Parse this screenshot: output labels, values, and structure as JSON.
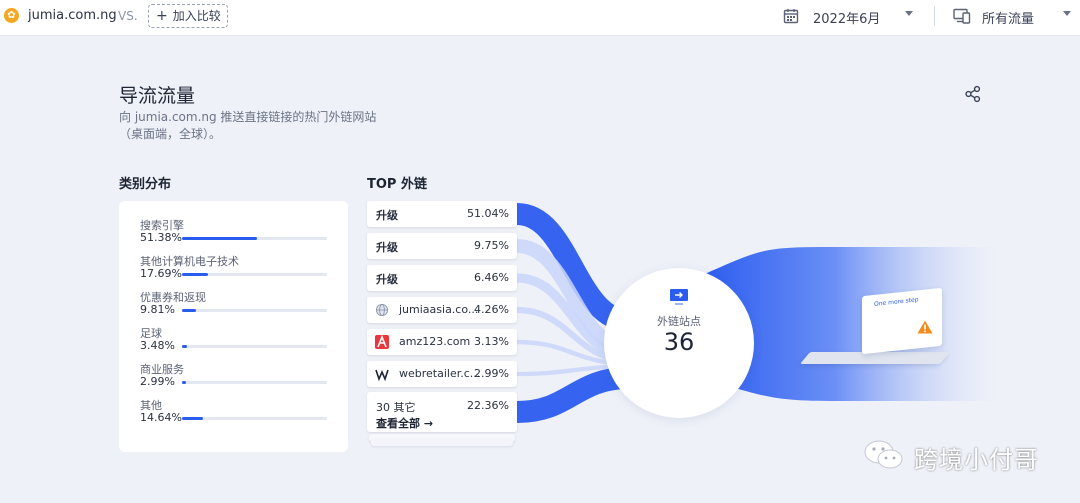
{
  "topbar": {
    "site": "jumia.com.ng",
    "vs": "VS.",
    "compare_label": "加入比较",
    "date": "2022年6月",
    "traffic_type": "所有流量"
  },
  "section": {
    "title": "导流流量",
    "description": "向 jumia.com.ng 推送直接链接的热门外链网站（桌面端，全球）。"
  },
  "categories": {
    "heading": "类别分布",
    "items": [
      {
        "name": "搜索引擎",
        "pct_label": "51.38%",
        "value": 51.38
      },
      {
        "name": "其他计算机电子技术",
        "pct_label": "17.69%",
        "value": 17.69
      },
      {
        "name": "优惠券和返现",
        "pct_label": "9.81%",
        "value": 9.81
      },
      {
        "name": "足球",
        "pct_label": "3.48%",
        "value": 3.48
      },
      {
        "name": "商业服务",
        "pct_label": "2.99%",
        "value": 2.99
      },
      {
        "name": "其他",
        "pct_label": "14.64%",
        "value": 14.64
      }
    ]
  },
  "top_links": {
    "heading": "TOP 外链",
    "items": [
      {
        "name": "升级",
        "pct": "51.04%",
        "icon": "none"
      },
      {
        "name": "升级",
        "pct": "9.75%",
        "icon": "none"
      },
      {
        "name": "升级",
        "pct": "6.46%",
        "icon": "none"
      },
      {
        "name": "jumiaasia.co...",
        "pct": "4.26%",
        "icon": "globe-icon"
      },
      {
        "name": "amz123.com",
        "pct": "3.13%",
        "icon": "amz123-logo-icon"
      },
      {
        "name": "webretailer.c...",
        "pct": "2.99%",
        "icon": "webretailer-logo-icon"
      }
    ],
    "others": {
      "name": "30 其它",
      "pct": "22.36%",
      "see_all": "查看全部 →"
    }
  },
  "center": {
    "label": "外链站点",
    "count": "36"
  },
  "illustration": {
    "screen_header": "One more step"
  },
  "watermark": {
    "text": "跨境小付哥"
  },
  "colors": {
    "accent": "#2b5cf0",
    "flow_light": "#c9d6fb"
  }
}
